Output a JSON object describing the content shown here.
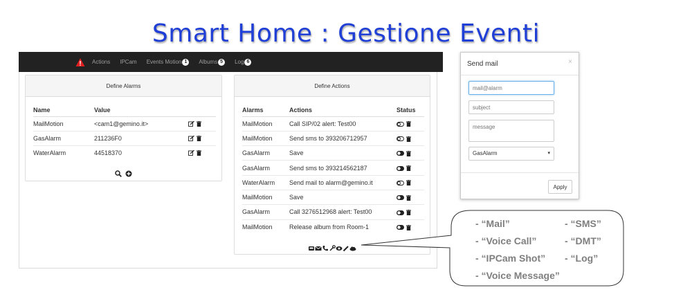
{
  "slide_title": "Smart Home : Gestione Eventi",
  "navbar": {
    "items": [
      {
        "label": "Actions",
        "badge": ""
      },
      {
        "label": "IPCam",
        "badge": ""
      },
      {
        "label": "Events Motion",
        "badge": "1"
      },
      {
        "label": "Albums",
        "badge": "5"
      },
      {
        "label": "Log",
        "badge": "6"
      }
    ]
  },
  "alarms_panel": {
    "title": "Define Alarms",
    "columns": [
      "Name",
      "Value"
    ],
    "rows": [
      {
        "name": "MailMotion",
        "value": "<cam1@gemino.it>"
      },
      {
        "name": "GasAlarm",
        "value": "211236F0"
      },
      {
        "name": "WaterAlarm",
        "value": "44518370"
      }
    ]
  },
  "actions_panel": {
    "title": "Define Actions",
    "columns": [
      "Alarms",
      "Actions",
      "Status"
    ],
    "rows": [
      {
        "alarm": "MailMotion",
        "action": "Call SIP/02 alert: Test00",
        "status": "off"
      },
      {
        "alarm": "MailMotion",
        "action": "Send sms to 393206712957",
        "status": "off"
      },
      {
        "alarm": "GasAlarm",
        "action": "Save",
        "status": "on"
      },
      {
        "alarm": "GasAlarm",
        "action": "Send sms to 393214562187",
        "status": "on"
      },
      {
        "alarm": "WaterAlarm",
        "action": "Send mail to alarm@gemino.it",
        "status": "off"
      },
      {
        "alarm": "MailMotion",
        "action": "Save",
        "status": "on"
      },
      {
        "alarm": "GasAlarm",
        "action": "Call 3276512968 alert: Test00",
        "status": "on"
      },
      {
        "alarm": "MailMotion",
        "action": "Release album from Room-1",
        "status": "on"
      }
    ],
    "footer_icons": [
      "inbox-icon",
      "envelope-icon",
      "phone-icon",
      "wrench-icon",
      "eye-icon",
      "pencil-icon",
      "cloud-icon"
    ]
  },
  "callout": {
    "items": [
      "- “Mail”",
      "- “SMS”",
      "- “Voice Call”",
      "- “DMT”",
      "- “IPCam Shot”",
      "- “Log”",
      "- “Voice Message”"
    ]
  },
  "modal": {
    "title": "Send mail",
    "close": "×",
    "to_placeholder": "mail@alarm",
    "subject_placeholder": "subject",
    "message_placeholder": "message",
    "select_value": "GasAlarm",
    "apply_label": "Apply"
  },
  "colors": {
    "title": "#1f3fd6",
    "navbar": "#222222",
    "alert": "#e02020",
    "callout_text": "#7f7f7f"
  }
}
